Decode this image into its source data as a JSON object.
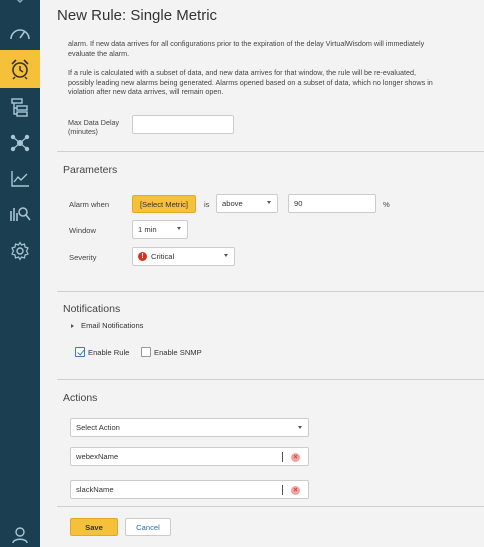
{
  "page": {
    "title": "New Rule: Single Metric"
  },
  "sidebar": {
    "items": [
      {
        "icon": "dashboard-gauge-icon",
        "active": false
      },
      {
        "icon": "alarm-clock-icon",
        "active": true
      },
      {
        "icon": "hierarchy-icon",
        "active": false
      },
      {
        "icon": "topology-icon",
        "active": false
      },
      {
        "icon": "line-chart-icon",
        "active": false
      },
      {
        "icon": "analytics-search-icon",
        "active": false
      },
      {
        "icon": "settings-gear-icon",
        "active": false
      },
      {
        "icon": "user-icon",
        "active": false
      }
    ],
    "bg_color": "#1b3e50",
    "active_color": "#f5c13b"
  },
  "description": {
    "para1_line1": "alarm. If new data arrives for all configurations prior to the expiration of the delay VirtualWisdom will immediately",
    "para1_line2": "evaluate the alarm.",
    "para2_line1": "If a rule is calculated with a subset of data, and new data arrives for that window, the rule will be re-evaluated,",
    "para2_line2": "possibly leading new alarms being generated. Alarms opened based on a subset of data, which no longer shows in",
    "para2_line3": "violation after new data arrives, will remain open.",
    "max_delay_label_line1": "Max Data Delay",
    "max_delay_label_line2": "(minutes)",
    "max_delay_value": ""
  },
  "parameters": {
    "title": "Parameters",
    "alarm_when_label": "Alarm when",
    "metric_button": "[Select Metric]",
    "is_label": "is",
    "comparison": "above",
    "threshold": "90",
    "unit": "%",
    "window_label": "Window",
    "window_value": "1 min",
    "severity_label": "Severity",
    "severity_value": "Critical",
    "severity_icon": "!"
  },
  "notifications": {
    "title": "Notifications",
    "email_expander": "Email Notifications",
    "enable_rule_label": "Enable Rule",
    "enable_rule_checked": true,
    "enable_snmp_label": "Enable SNMP",
    "enable_snmp_checked": false
  },
  "actions": {
    "title": "Actions",
    "select_placeholder": "Select Action",
    "items": [
      {
        "name": "webexName"
      },
      {
        "name": "slackName"
      }
    ]
  },
  "footer": {
    "save_label": "Save",
    "cancel_label": "Cancel"
  },
  "colors": {
    "accent": "#f5c13b",
    "link": "#2e6fa7",
    "critical": "#d9321f"
  }
}
